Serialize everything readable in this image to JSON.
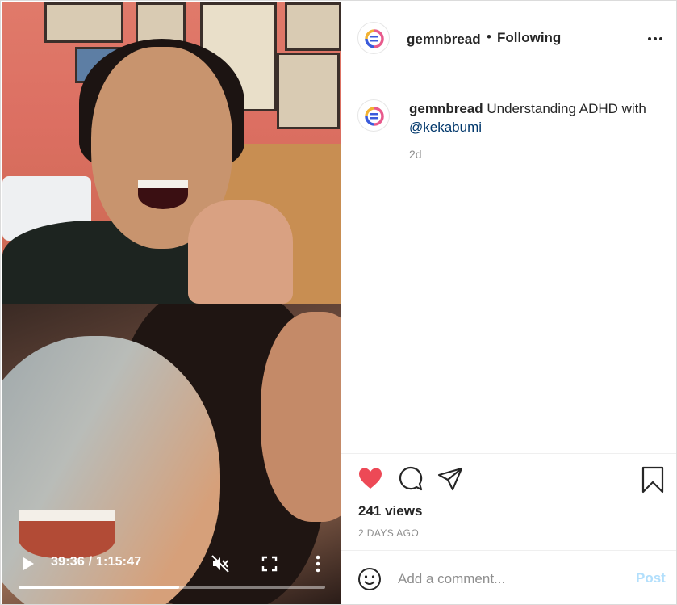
{
  "colors": {
    "text": "#262626",
    "secondary_text": "#8e8e8e",
    "mention": "#00376b",
    "like_red": "#ed4956",
    "post_button_disabled": "#b2dffc",
    "divider": "#efefef"
  },
  "video": {
    "time_display": "39:36 / 1:15:47",
    "progress_fraction": 0.524,
    "icons": [
      "play-icon",
      "muted-icon",
      "fullscreen-icon",
      "more-vertical-icon"
    ]
  },
  "header": {
    "avatar_icon": "gem-and-bread-logo",
    "username": "gemnbread",
    "separator": "•",
    "follow_status": "Following",
    "more_icon": "more-horizontal-icon"
  },
  "caption": {
    "username": "gemnbread",
    "text": " Understanding ADHD with ",
    "mention": "@kekabumi",
    "time": "2d"
  },
  "actions": {
    "liked": true,
    "icons": [
      "heart-filled-icon",
      "comment-icon",
      "share-icon",
      "bookmark-icon"
    ],
    "views": "241 views",
    "posted_ago": "2 DAYS AGO"
  },
  "comment_box": {
    "placeholder": "Add a comment...",
    "value": "",
    "post_label": "Post",
    "emoji_icon": "smiley-icon"
  }
}
